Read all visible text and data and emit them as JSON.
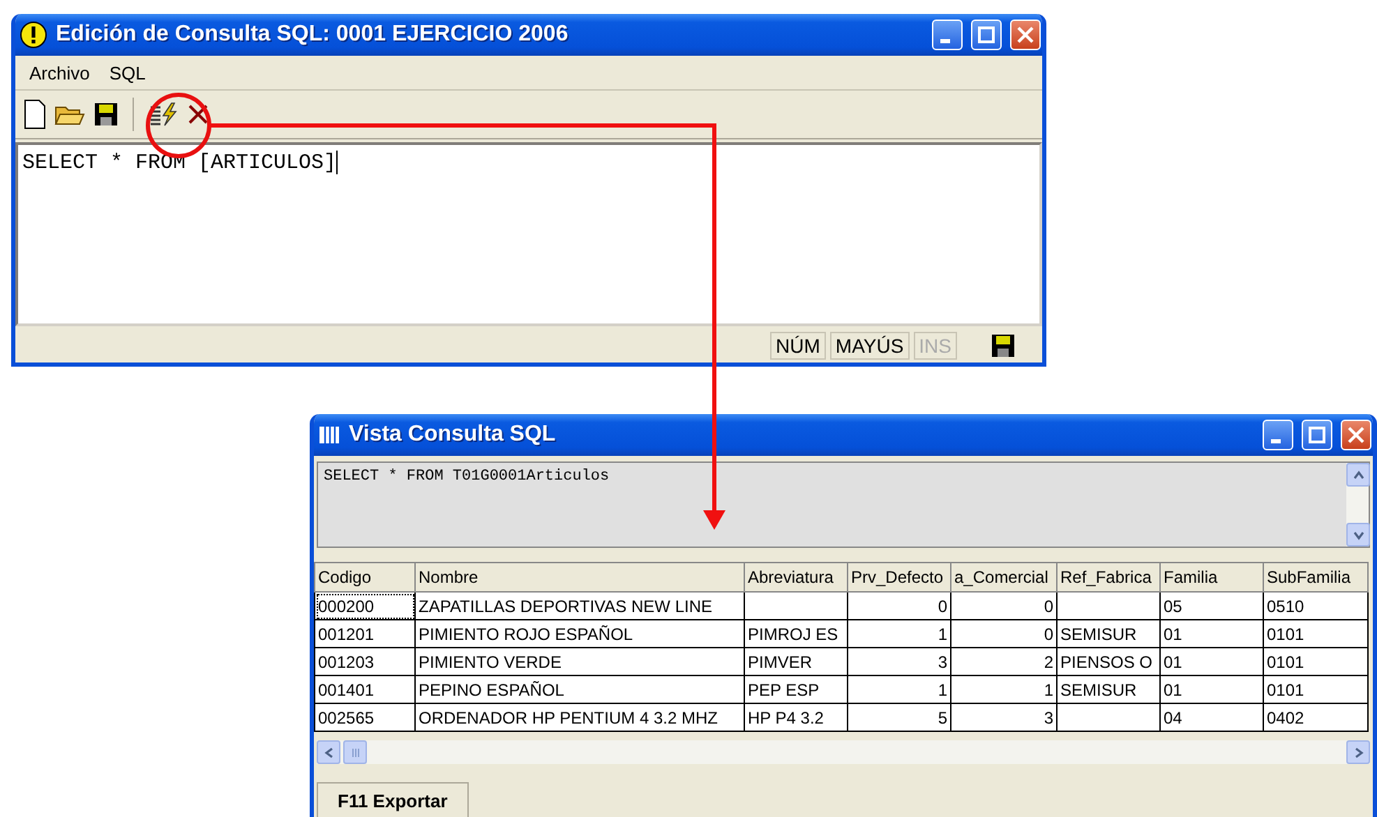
{
  "editor_window": {
    "title": "Edición de Consulta SQL: 0001 EJERCICIO 2006",
    "menu": [
      "Archivo",
      "SQL"
    ],
    "query": "SELECT * FROM [ARTICULOS]",
    "status_indicators": [
      {
        "label": "NÚM",
        "active": true
      },
      {
        "label": "MAYÚS",
        "active": true
      },
      {
        "label": "INS",
        "active": false
      }
    ]
  },
  "view_window": {
    "title": "Vista Consulta SQL",
    "query": "SELECT * FROM T01G0001Articulos",
    "table": {
      "columns": [
        {
          "label": "Codigo",
          "kind": "text"
        },
        {
          "label": "Nombre",
          "kind": "text"
        },
        {
          "label": "Abreviatura",
          "kind": "text"
        },
        {
          "label": "Prv_Defecto",
          "kind": "number"
        },
        {
          "label": "a_Comercial",
          "kind": "number"
        },
        {
          "label": "Ref_Fabrica",
          "kind": "text"
        },
        {
          "label": "Familia",
          "kind": "text"
        },
        {
          "label": "SubFamilia",
          "kind": "text"
        }
      ],
      "rows": [
        {
          "focused": true,
          "cells": [
            "000200",
            "ZAPATILLAS DEPORTIVAS NEW LINE",
            "",
            "0",
            "0",
            "",
            "05",
            "0510"
          ]
        },
        {
          "focused": false,
          "cells": [
            "001201",
            "PIMIENTO ROJO ESPAÑOL",
            "PIMROJ ES",
            "1",
            "0",
            "SEMISUR",
            "01",
            "0101"
          ]
        },
        {
          "focused": false,
          "cells": [
            "001203",
            "PIMIENTO VERDE",
            "PIMVER",
            "3",
            "2",
            "PIENSOS O",
            "01",
            "0101"
          ]
        },
        {
          "focused": false,
          "cells": [
            "001401",
            "PEPINO ESPAÑOL",
            "PEP ESP",
            "1",
            "1",
            "SEMISUR",
            "01",
            "0101"
          ]
        },
        {
          "focused": false,
          "cells": [
            "002565",
            "ORDENADOR HP PENTIUM 4 3.2 MHZ",
            "HP P4 3.2",
            "5",
            "3",
            "",
            "04",
            "0402"
          ]
        }
      ]
    },
    "export_button": "F11 Exportar"
  }
}
